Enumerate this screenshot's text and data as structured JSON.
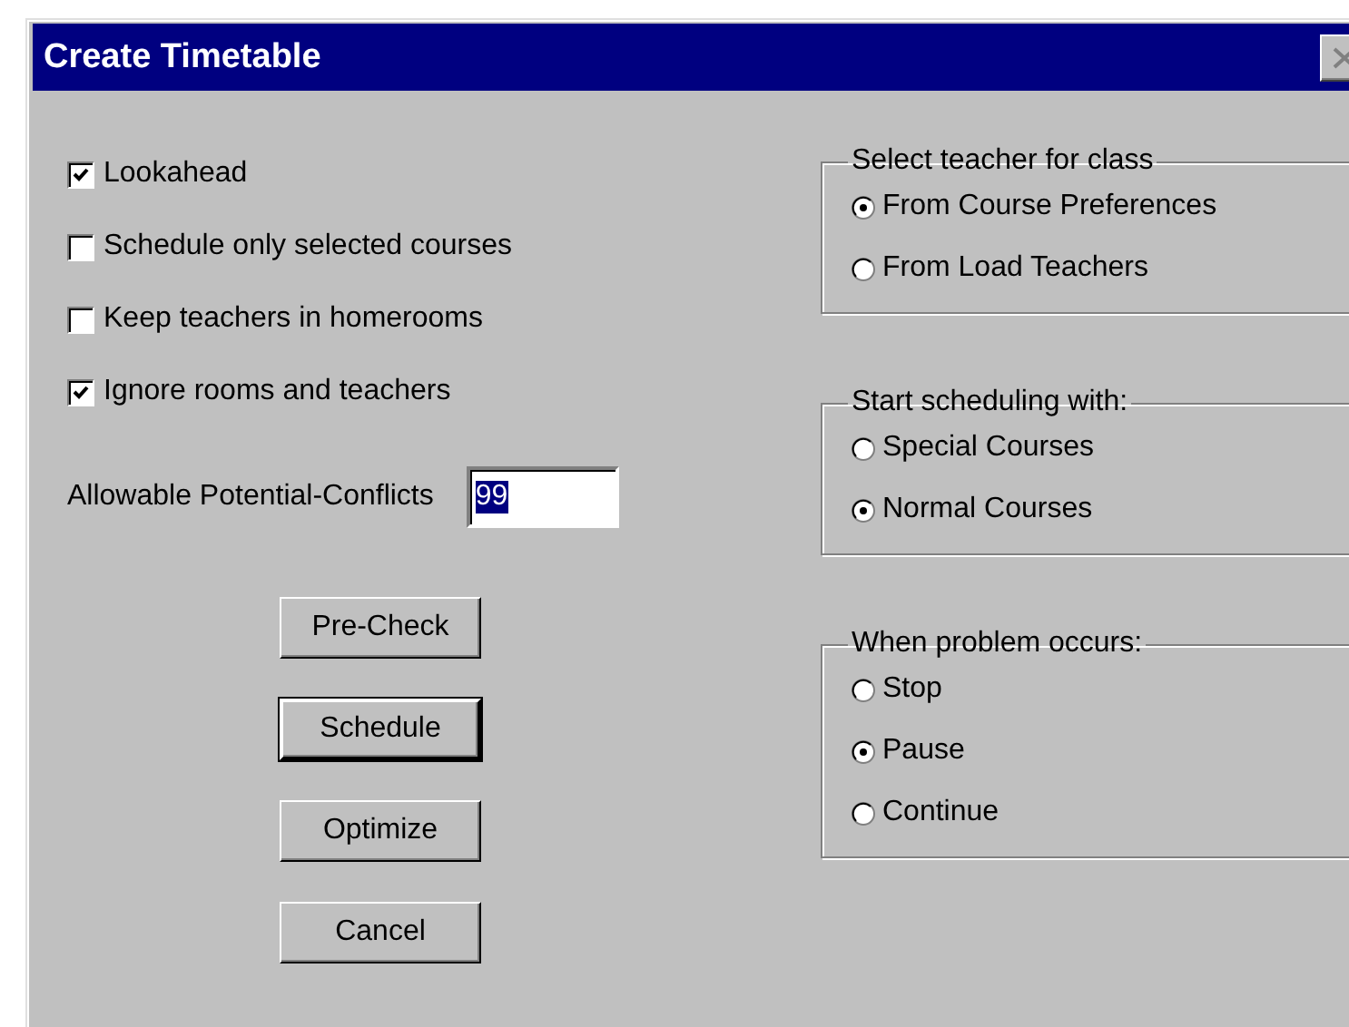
{
  "window": {
    "title": "Create Timetable"
  },
  "options": [
    {
      "label": "Lookahead",
      "checked": true
    },
    {
      "label": "Schedule only selected courses",
      "checked": false
    },
    {
      "label": "Keep teachers in homerooms",
      "checked": false
    },
    {
      "label": "Ignore rooms and teachers",
      "checked": true
    }
  ],
  "conflicts": {
    "label": "Allowable Potential-Conflicts",
    "value": "99",
    "text_selected": true
  },
  "buttons": [
    {
      "label": "Pre-Check",
      "default": false
    },
    {
      "label": "Schedule",
      "default": true
    },
    {
      "label": "Optimize",
      "default": false
    },
    {
      "label": "Cancel",
      "default": false
    }
  ],
  "groups": [
    {
      "title": "Select teacher for class",
      "options": [
        {
          "label": "From Course Preferences",
          "selected": true
        },
        {
          "label": "From Load Teachers",
          "selected": false
        }
      ]
    },
    {
      "title": "Start scheduling with:",
      "options": [
        {
          "label": "Special Courses",
          "selected": false
        },
        {
          "label": "Normal Courses",
          "selected": true
        }
      ]
    },
    {
      "title": "When problem occurs:",
      "options": [
        {
          "label": "Stop",
          "selected": false
        },
        {
          "label": "Pause",
          "selected": true
        },
        {
          "label": "Continue",
          "selected": false
        }
      ]
    }
  ]
}
